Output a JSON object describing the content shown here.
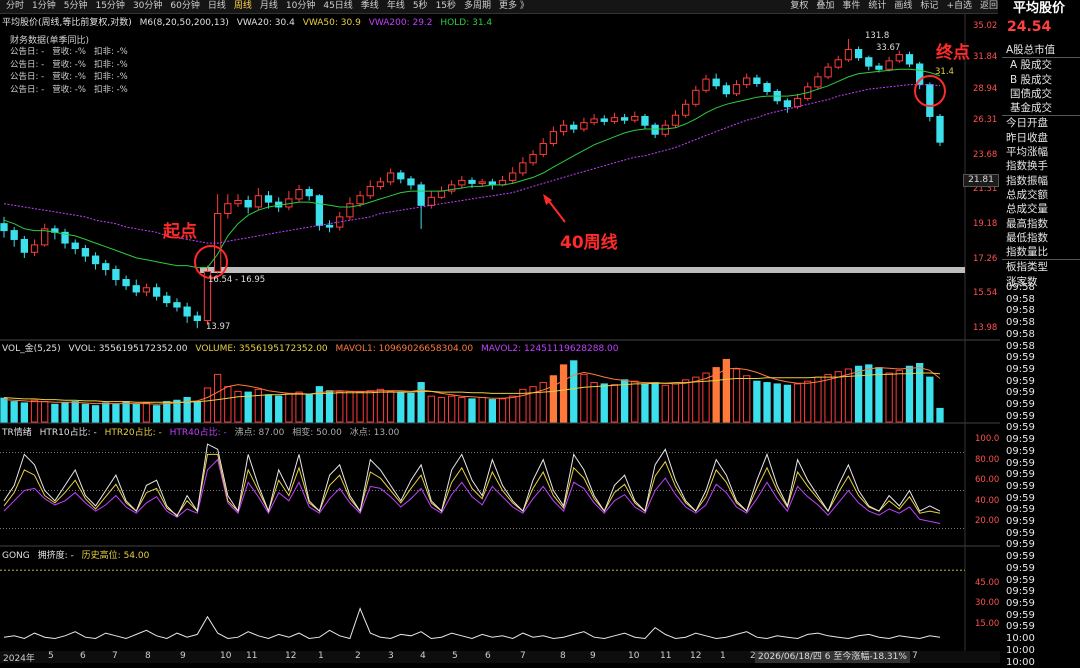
{
  "app": {
    "title": "平均股价"
  },
  "topbar": {
    "tabs": [
      "分时",
      "1分钟",
      "5分钟",
      "15分钟",
      "30分钟",
      "60分钟",
      "日线",
      "周线",
      "月线",
      "10分钟",
      "45日线",
      "季线",
      "年线",
      "5秒",
      "15秒",
      "多周期",
      "更多 》"
    ],
    "active_tab": "周线",
    "tools": [
      "复权",
      "叠加",
      "事件",
      "统计",
      "画线",
      "标记",
      "+自选",
      "返回"
    ]
  },
  "main_header": {
    "name": "平均股价(周线,等比前复权,对数)",
    "ma_label": "M6(8,20,50,200,13)",
    "vwa20": "VWA20: 30.4",
    "vwa50": "VWA50: 30.9",
    "vwa200": "VWA200: 29.2",
    "hold": "HOLD: 31.4"
  },
  "finance": {
    "title": "财务数据(单季同比)",
    "rows": [
      "公告日: -   营收: -%   扣非: -%",
      "公告日: -   营收: -%   扣非: -%",
      "公告日: -   营收: -%   扣非: -%",
      "公告日: -   营收: -%   扣非: -%"
    ]
  },
  "annotations": {
    "start": "起点",
    "end": "终点",
    "ma40": "40周线",
    "high_label": "131.8",
    "high_price": "33.67",
    "low_price": "13.97",
    "range_label": "16.54 - 16.95",
    "hold_value": "31.4"
  },
  "price_axis": [
    "35.02",
    "31.84",
    "28.94",
    "26.31",
    "23.68",
    "21.31",
    "19.18",
    "17.26",
    "15.54",
    "13.98"
  ],
  "price_box": "21.81",
  "vol_header": {
    "name": "VOL_金(5,25)",
    "vvol": "VVOL: 3556195172352.00",
    "volume": "VOLUME: 3556195172352.00",
    "mavol1": "MAVOL1: 10969026658304.00",
    "mavol2": "MAVOL2: 12451119628288.00"
  },
  "tr_header": {
    "name": "TR情绪",
    "h10": "HTR10占比: -",
    "h20": "HTR20占比: -",
    "h40": "HTR40占比: -",
    "hot": "沸点: 87.00",
    "neutral": "相变: 50.00",
    "ice": "冰点: 13.00"
  },
  "tr_axis": [
    "100.0",
    "80.00",
    "60.00",
    "40.00",
    "20.00"
  ],
  "gong_header": {
    "name": "GONG",
    "crowd": "拥挤度: -",
    "hist": "历史高位: 54.00"
  },
  "gong_axis": [
    "45.00",
    "30.00",
    "15.00"
  ],
  "date_axis": [
    "2024年",
    "5",
    "6",
    "7",
    "8",
    "9",
    "10",
    "11",
    "12",
    "1",
    "2",
    "3",
    "4",
    "5",
    "6",
    "7",
    "8",
    "9",
    "10",
    "11",
    "12",
    "1",
    "2",
    "3",
    "4",
    "5",
    "6",
    "7"
  ],
  "date_annot": "2026/06/18/四 6 至今涨幅-18.31%",
  "side_menu": {
    "header": "A股总市值",
    "group1": [
      "A 股成交",
      "B 股成交",
      "国债成交",
      "基金成交"
    ],
    "group2": [
      "今日开盘",
      "昨日收盘",
      "平均涨幅",
      "指数换手",
      "指数振幅",
      "总成交额",
      "总成交量",
      "最高指数",
      "最低指数",
      "指数量比"
    ],
    "group3": [
      "板指类型",
      "涨家数"
    ]
  },
  "time_col": [
    "09:58",
    "09:58",
    "09:58",
    "09:58",
    "09:58",
    "09:58",
    "09:59",
    "09:59",
    "09:59",
    "09:59",
    "09:59",
    "09:59",
    "09:59",
    "09:59",
    "09:59",
    "09:59",
    "09:59",
    "09:59",
    "09:59",
    "09:59",
    "09:59",
    "09:59",
    "09:59",
    "09:59",
    "09:59",
    "09:59",
    "09:59",
    "09:59",
    "09:59",
    "09:59",
    "10:00",
    "10:00",
    "10:00"
  ],
  "side_bottom": "周线",
  "side_price": "24.54",
  "colors": {
    "up": "#ff3b3b",
    "down": "#3ce0ec",
    "ma_green": "#2ecc40",
    "ma_purple": "#c040ff",
    "annot_red": "#ff2a2a",
    "yellow": "#e8d040",
    "orange": "#ff7a3a"
  },
  "chart_data": {
    "type": "candlestick",
    "scale": "log",
    "ylim": [
      13.98,
      35.02
    ],
    "candles": [
      [
        19.2,
        18.8,
        19.6,
        18.4
      ],
      [
        18.8,
        18.3,
        19.0,
        17.9
      ],
      [
        18.3,
        17.6,
        18.5,
        17.3
      ],
      [
        17.6,
        18.0,
        18.3,
        17.4
      ],
      [
        18.0,
        18.9,
        19.2,
        17.9
      ],
      [
        18.9,
        18.7,
        19.1,
        18.3
      ],
      [
        18.7,
        18.1,
        18.9,
        17.8
      ],
      [
        18.1,
        17.8,
        18.3,
        17.5
      ],
      [
        17.8,
        17.4,
        18.0,
        17.1
      ],
      [
        17.4,
        17.0,
        17.6,
        16.7
      ],
      [
        17.0,
        16.7,
        17.2,
        16.4
      ],
      [
        16.7,
        16.2,
        16.9,
        15.9
      ],
      [
        16.2,
        15.9,
        16.4,
        15.7
      ],
      [
        15.9,
        15.6,
        16.2,
        15.4
      ],
      [
        15.6,
        15.8,
        16.0,
        15.4
      ],
      [
        15.8,
        15.4,
        16.0,
        15.2
      ],
      [
        15.4,
        15.1,
        15.6,
        14.9
      ],
      [
        15.1,
        14.9,
        15.3,
        14.7
      ],
      [
        14.9,
        14.5,
        15.1,
        14.2
      ],
      [
        14.5,
        14.3,
        14.7,
        13.97
      ],
      [
        14.3,
        16.6,
        16.9,
        14.1
      ],
      [
        16.6,
        19.8,
        21.0,
        16.5
      ],
      [
        19.8,
        20.4,
        21.0,
        19.5
      ],
      [
        20.4,
        20.6,
        21.0,
        20.2
      ],
      [
        20.6,
        20.2,
        20.9,
        19.8
      ],
      [
        20.2,
        20.9,
        21.4,
        20.0
      ],
      [
        20.9,
        20.5,
        21.2,
        20.1
      ],
      [
        20.5,
        20.2,
        20.8,
        19.9
      ],
      [
        20.2,
        20.7,
        21.2,
        20.0
      ],
      [
        20.7,
        21.3,
        21.6,
        20.5
      ],
      [
        21.3,
        20.9,
        21.5,
        20.6
      ],
      [
        20.9,
        19.1,
        21.0,
        18.8
      ],
      [
        19.1,
        19.0,
        19.4,
        18.7
      ],
      [
        19.0,
        19.6,
        19.9,
        18.8
      ],
      [
        19.6,
        20.4,
        20.8,
        19.4
      ],
      [
        20.4,
        20.9,
        21.2,
        20.2
      ],
      [
        20.9,
        21.5,
        21.9,
        20.7
      ],
      [
        21.5,
        21.8,
        22.1,
        21.3
      ],
      [
        21.8,
        22.4,
        22.7,
        21.6
      ],
      [
        22.4,
        22.0,
        22.6,
        21.7
      ],
      [
        22.0,
        21.6,
        22.2,
        21.3
      ],
      [
        21.6,
        20.3,
        21.8,
        18.9
      ],
      [
        20.3,
        20.8,
        21.2,
        20.1
      ],
      [
        20.8,
        21.2,
        21.5,
        20.7
      ],
      [
        21.2,
        21.6,
        21.9,
        21.0
      ],
      [
        21.6,
        21.9,
        22.2,
        21.4
      ],
      [
        21.9,
        21.7,
        22.1,
        21.4
      ],
      [
        21.7,
        21.8,
        22.0,
        21.5
      ],
      [
        21.8,
        21.6,
        22.0,
        21.3
      ],
      [
        21.6,
        21.9,
        22.2,
        21.5
      ],
      [
        21.9,
        22.4,
        22.8,
        21.7
      ],
      [
        22.4,
        23.1,
        23.5,
        22.2
      ],
      [
        23.1,
        23.7,
        24.0,
        22.9
      ],
      [
        23.7,
        24.5,
        24.9,
        23.5
      ],
      [
        24.5,
        25.4,
        25.8,
        24.3
      ],
      [
        25.4,
        25.9,
        26.3,
        25.1
      ],
      [
        25.9,
        25.6,
        26.2,
        25.3
      ],
      [
        25.6,
        26.1,
        26.5,
        25.4
      ],
      [
        26.1,
        26.4,
        26.8,
        25.9
      ],
      [
        26.4,
        26.2,
        26.7,
        25.9
      ],
      [
        26.2,
        26.5,
        26.9,
        26.0
      ],
      [
        26.5,
        26.3,
        26.8,
        26.0
      ],
      [
        26.3,
        26.6,
        27.0,
        26.1
      ],
      [
        26.6,
        25.9,
        26.8,
        25.6
      ],
      [
        25.9,
        25.2,
        26.1,
        24.9
      ],
      [
        25.2,
        25.9,
        26.3,
        25.0
      ],
      [
        25.9,
        26.7,
        27.1,
        25.7
      ],
      [
        26.7,
        27.6,
        28.0,
        26.5
      ],
      [
        27.6,
        28.8,
        29.2,
        27.4
      ],
      [
        28.8,
        29.8,
        30.2,
        28.6
      ],
      [
        29.8,
        29.2,
        30.3,
        28.9
      ],
      [
        29.2,
        28.5,
        29.5,
        28.2
      ],
      [
        28.5,
        29.3,
        29.7,
        28.3
      ],
      [
        29.3,
        29.9,
        30.3,
        29.0
      ],
      [
        29.9,
        29.4,
        30.2,
        29.1
      ],
      [
        29.4,
        28.7,
        29.6,
        28.4
      ],
      [
        28.7,
        27.9,
        28.9,
        27.6
      ],
      [
        27.9,
        27.4,
        28.1,
        26.9
      ],
      [
        27.4,
        28.1,
        28.5,
        27.2
      ],
      [
        28.1,
        29.1,
        29.5,
        27.9
      ],
      [
        29.1,
        30.0,
        30.4,
        28.9
      ],
      [
        30.0,
        30.9,
        31.3,
        29.8
      ],
      [
        30.9,
        31.6,
        32.0,
        30.7
      ],
      [
        31.6,
        32.6,
        33.67,
        31.4
      ],
      [
        32.6,
        31.8,
        32.9,
        31.5
      ],
      [
        31.8,
        31.0,
        32.0,
        30.6
      ],
      [
        31.0,
        30.7,
        31.3,
        30.4
      ],
      [
        30.7,
        31.5,
        31.9,
        30.5
      ],
      [
        31.5,
        32.1,
        32.5,
        31.3
      ],
      [
        32.1,
        31.2,
        32.4,
        30.9
      ],
      [
        31.2,
        29.3,
        31.4,
        28.9
      ],
      [
        29.3,
        26.6,
        29.5,
        26.2
      ],
      [
        26.6,
        24.6,
        26.8,
        24.3
      ]
    ],
    "ma_green": [
      19.4,
      19.2,
      18.9,
      18.8,
      18.8,
      18.7,
      18.6,
      18.5,
      18.3,
      18.1,
      17.9,
      17.7,
      17.5,
      17.3,
      17.2,
      17.1,
      17.0,
      16.9,
      16.9,
      16.8,
      16.8,
      17.5,
      18.5,
      19.2,
      19.7,
      20.0,
      20.2,
      20.3,
      20.4,
      20.5,
      20.5,
      20.4,
      20.3,
      20.2,
      20.2,
      20.3,
      20.5,
      20.7,
      20.9,
      21.1,
      21.2,
      21.2,
      21.2,
      21.2,
      21.3,
      21.4,
      21.5,
      21.5,
      21.6,
      21.6,
      21.7,
      21.9,
      22.1,
      22.4,
      22.8,
      23.2,
      23.6,
      24.0,
      24.4,
      24.7,
      25.0,
      25.3,
      25.5,
      25.6,
      25.6,
      25.6,
      25.7,
      26.0,
      26.4,
      26.9,
      27.3,
      27.6,
      27.8,
      28.0,
      28.2,
      28.3,
      28.3,
      28.3,
      28.4,
      28.6,
      28.9,
      29.2,
      29.6,
      30.0,
      30.3,
      30.4,
      30.5,
      30.6,
      30.7,
      30.7,
      30.6,
      30.4,
      30.1
    ],
    "ma40": [
      20.4,
      20.3,
      20.2,
      20.1,
      20.0,
      19.9,
      19.8,
      19.7,
      19.6,
      19.4,
      19.3,
      19.2,
      19.0,
      18.9,
      18.8,
      18.7,
      18.5,
      18.4,
      18.3,
      18.2,
      18.1,
      18.1,
      18.2,
      18.3,
      18.4,
      18.5,
      18.6,
      18.7,
      18.8,
      18.9,
      19.0,
      19.1,
      19.2,
      19.3,
      19.4,
      19.5,
      19.6,
      19.8,
      19.9,
      20.0,
      20.1,
      20.2,
      20.3,
      20.4,
      20.5,
      20.6,
      20.7,
      20.8,
      20.9,
      21.0,
      21.1,
      21.3,
      21.5,
      21.7,
      21.9,
      22.1,
      22.3,
      22.5,
      22.7,
      22.9,
      23.1,
      23.3,
      23.5,
      23.6,
      23.8,
      24.0,
      24.2,
      24.5,
      24.8,
      25.1,
      25.4,
      25.7,
      26.0,
      26.3,
      26.5,
      26.8,
      27.0,
      27.2,
      27.4,
      27.6,
      27.8,
      28.0,
      28.3,
      28.5,
      28.7,
      28.9,
      29.0,
      29.1,
      29.2,
      29.3,
      29.3,
      29.3,
      29.2
    ],
    "volume_ylim": [
      0,
      100
    ],
    "volume": [
      35,
      30,
      28,
      32,
      30,
      26,
      28,
      30,
      26,
      24,
      28,
      26,
      30,
      26,
      28,
      24,
      30,
      32,
      36,
      30,
      50,
      70,
      52,
      45,
      44,
      48,
      40,
      38,
      42,
      44,
      40,
      52,
      46,
      44,
      45,
      44,
      46,
      48,
      45,
      44,
      42,
      58,
      38,
      36,
      38,
      36,
      34,
      36,
      33,
      34,
      38,
      48,
      52,
      58,
      68,
      84,
      90,
      70,
      58,
      56,
      55,
      62,
      60,
      56,
      58,
      54,
      56,
      62,
      66,
      72,
      80,
      92,
      78,
      68,
      60,
      58,
      56,
      54,
      56,
      60,
      66,
      70,
      74,
      78,
      82,
      84,
      80,
      72,
      76,
      82,
      86,
      66,
      20
    ],
    "vol_highlight": [
      54,
      55,
      70,
      71
    ],
    "mavol1": [
      33,
      32,
      31,
      30,
      30,
      29,
      29,
      29,
      28,
      27,
      27,
      27,
      27,
      27,
      27,
      26,
      27,
      28,
      30,
      31,
      36,
      44,
      52,
      55,
      53,
      50,
      46,
      44,
      42,
      42,
      41,
      43,
      45,
      46,
      45,
      45,
      45,
      46,
      46,
      46,
      45,
      47,
      45,
      42,
      40,
      38,
      37,
      36,
      35,
      35,
      36,
      39,
      43,
      47,
      53,
      61,
      69,
      73,
      70,
      66,
      63,
      61,
      59,
      58,
      58,
      57,
      56,
      57,
      60,
      64,
      70,
      78,
      79,
      77,
      73,
      67,
      62,
      59,
      57,
      57,
      59,
      62,
      66,
      70,
      74,
      78,
      80,
      79,
      78,
      79,
      80,
      76,
      64
    ],
    "mavol2": [
      36,
      35,
      34,
      34,
      33,
      33,
      32,
      32,
      31,
      31,
      30,
      30,
      30,
      29,
      29,
      29,
      29,
      29,
      29,
      30,
      31,
      33,
      35,
      37,
      38,
      39,
      40,
      40,
      41,
      41,
      41,
      42,
      42,
      43,
      43,
      43,
      43,
      44,
      44,
      44,
      44,
      45,
      45,
      44,
      44,
      44,
      43,
      43,
      42,
      42,
      42,
      42,
      43,
      44,
      45,
      47,
      49,
      51,
      52,
      53,
      54,
      55,
      56,
      56,
      57,
      57,
      58,
      58,
      59,
      60,
      61,
      63,
      64,
      64,
      64,
      65,
      65,
      65,
      65,
      65,
      66,
      66,
      66,
      67,
      68,
      69,
      70,
      70,
      71,
      71,
      72,
      72,
      71
    ],
    "tr_ylim": [
      0,
      100
    ],
    "tr_white": [
      40,
      55,
      85,
      75,
      50,
      40,
      55,
      70,
      45,
      35,
      50,
      65,
      40,
      30,
      55,
      60,
      35,
      25,
      45,
      30,
      95,
      90,
      45,
      30,
      85,
      55,
      30,
      70,
      50,
      85,
      40,
      30,
      65,
      75,
      45,
      30,
      80,
      70,
      55,
      40,
      60,
      75,
      40,
      30,
      70,
      85,
      60,
      45,
      80,
      55,
      40,
      30,
      60,
      80,
      50,
      35,
      85,
      70,
      45,
      30,
      55,
      65,
      40,
      30,
      75,
      90,
      60,
      40,
      30,
      50,
      80,
      65,
      40,
      30,
      60,
      85,
      55,
      35,
      80,
      60,
      45,
      30,
      55,
      75,
      50,
      35,
      30,
      45,
      35,
      50,
      30,
      35,
      30
    ],
    "tr_yellow": [
      35,
      48,
      70,
      65,
      45,
      38,
      48,
      60,
      42,
      32,
      44,
      56,
      38,
      30,
      48,
      52,
      33,
      26,
      40,
      30,
      85,
      85,
      40,
      30,
      70,
      50,
      30,
      60,
      45,
      72,
      38,
      30,
      55,
      65,
      42,
      30,
      68,
      62,
      50,
      38,
      52,
      65,
      38,
      30,
      58,
      72,
      52,
      42,
      68,
      50,
      38,
      30,
      52,
      68,
      45,
      33,
      72,
      62,
      42,
      30,
      48,
      56,
      38,
      30,
      64,
      78,
      54,
      38,
      30,
      44,
      70,
      58,
      38,
      30,
      52,
      72,
      50,
      34,
      68,
      54,
      42,
      30,
      48,
      64,
      45,
      34,
      30,
      40,
      32,
      44,
      28,
      30,
      28
    ],
    "tr_purple": [
      30,
      40,
      50,
      52,
      42,
      36,
      40,
      48,
      38,
      30,
      36,
      45,
      34,
      28,
      38,
      44,
      30,
      24,
      32,
      28,
      70,
      80,
      38,
      28,
      58,
      44,
      28,
      48,
      40,
      58,
      34,
      28,
      42,
      52,
      38,
      28,
      54,
      52,
      44,
      34,
      42,
      52,
      34,
      28,
      46,
      58,
      44,
      36,
      54,
      44,
      34,
      28,
      42,
      54,
      40,
      30,
      58,
      52,
      38,
      28,
      40,
      46,
      34,
      28,
      50,
      62,
      46,
      34,
      28,
      36,
      56,
      48,
      34,
      28,
      42,
      58,
      42,
      30,
      54,
      44,
      36,
      26,
      38,
      50,
      38,
      30,
      26,
      32,
      28,
      34,
      22,
      20,
      18
    ],
    "gong_ylim": [
      0,
      60
    ],
    "gong": [
      5,
      6,
      4,
      8,
      5,
      4,
      6,
      9,
      5,
      4,
      8,
      6,
      4,
      7,
      10,
      6,
      4,
      8,
      5,
      7,
      20,
      8,
      4,
      5,
      9,
      6,
      4,
      7,
      5,
      8,
      4,
      5,
      10,
      6,
      4,
      26,
      8,
      5,
      4,
      7,
      6,
      9,
      4,
      5,
      8,
      6,
      4,
      7,
      5,
      6,
      4,
      8,
      5,
      6,
      4,
      5,
      7,
      9,
      5,
      4,
      6,
      8,
      5,
      4,
      12,
      7,
      4,
      5,
      8,
      6,
      4,
      5,
      7,
      9,
      5,
      4,
      6,
      5,
      4,
      7,
      8,
      6,
      5,
      4,
      6,
      7,
      5,
      4,
      6,
      5,
      4,
      6,
      5
    ]
  }
}
